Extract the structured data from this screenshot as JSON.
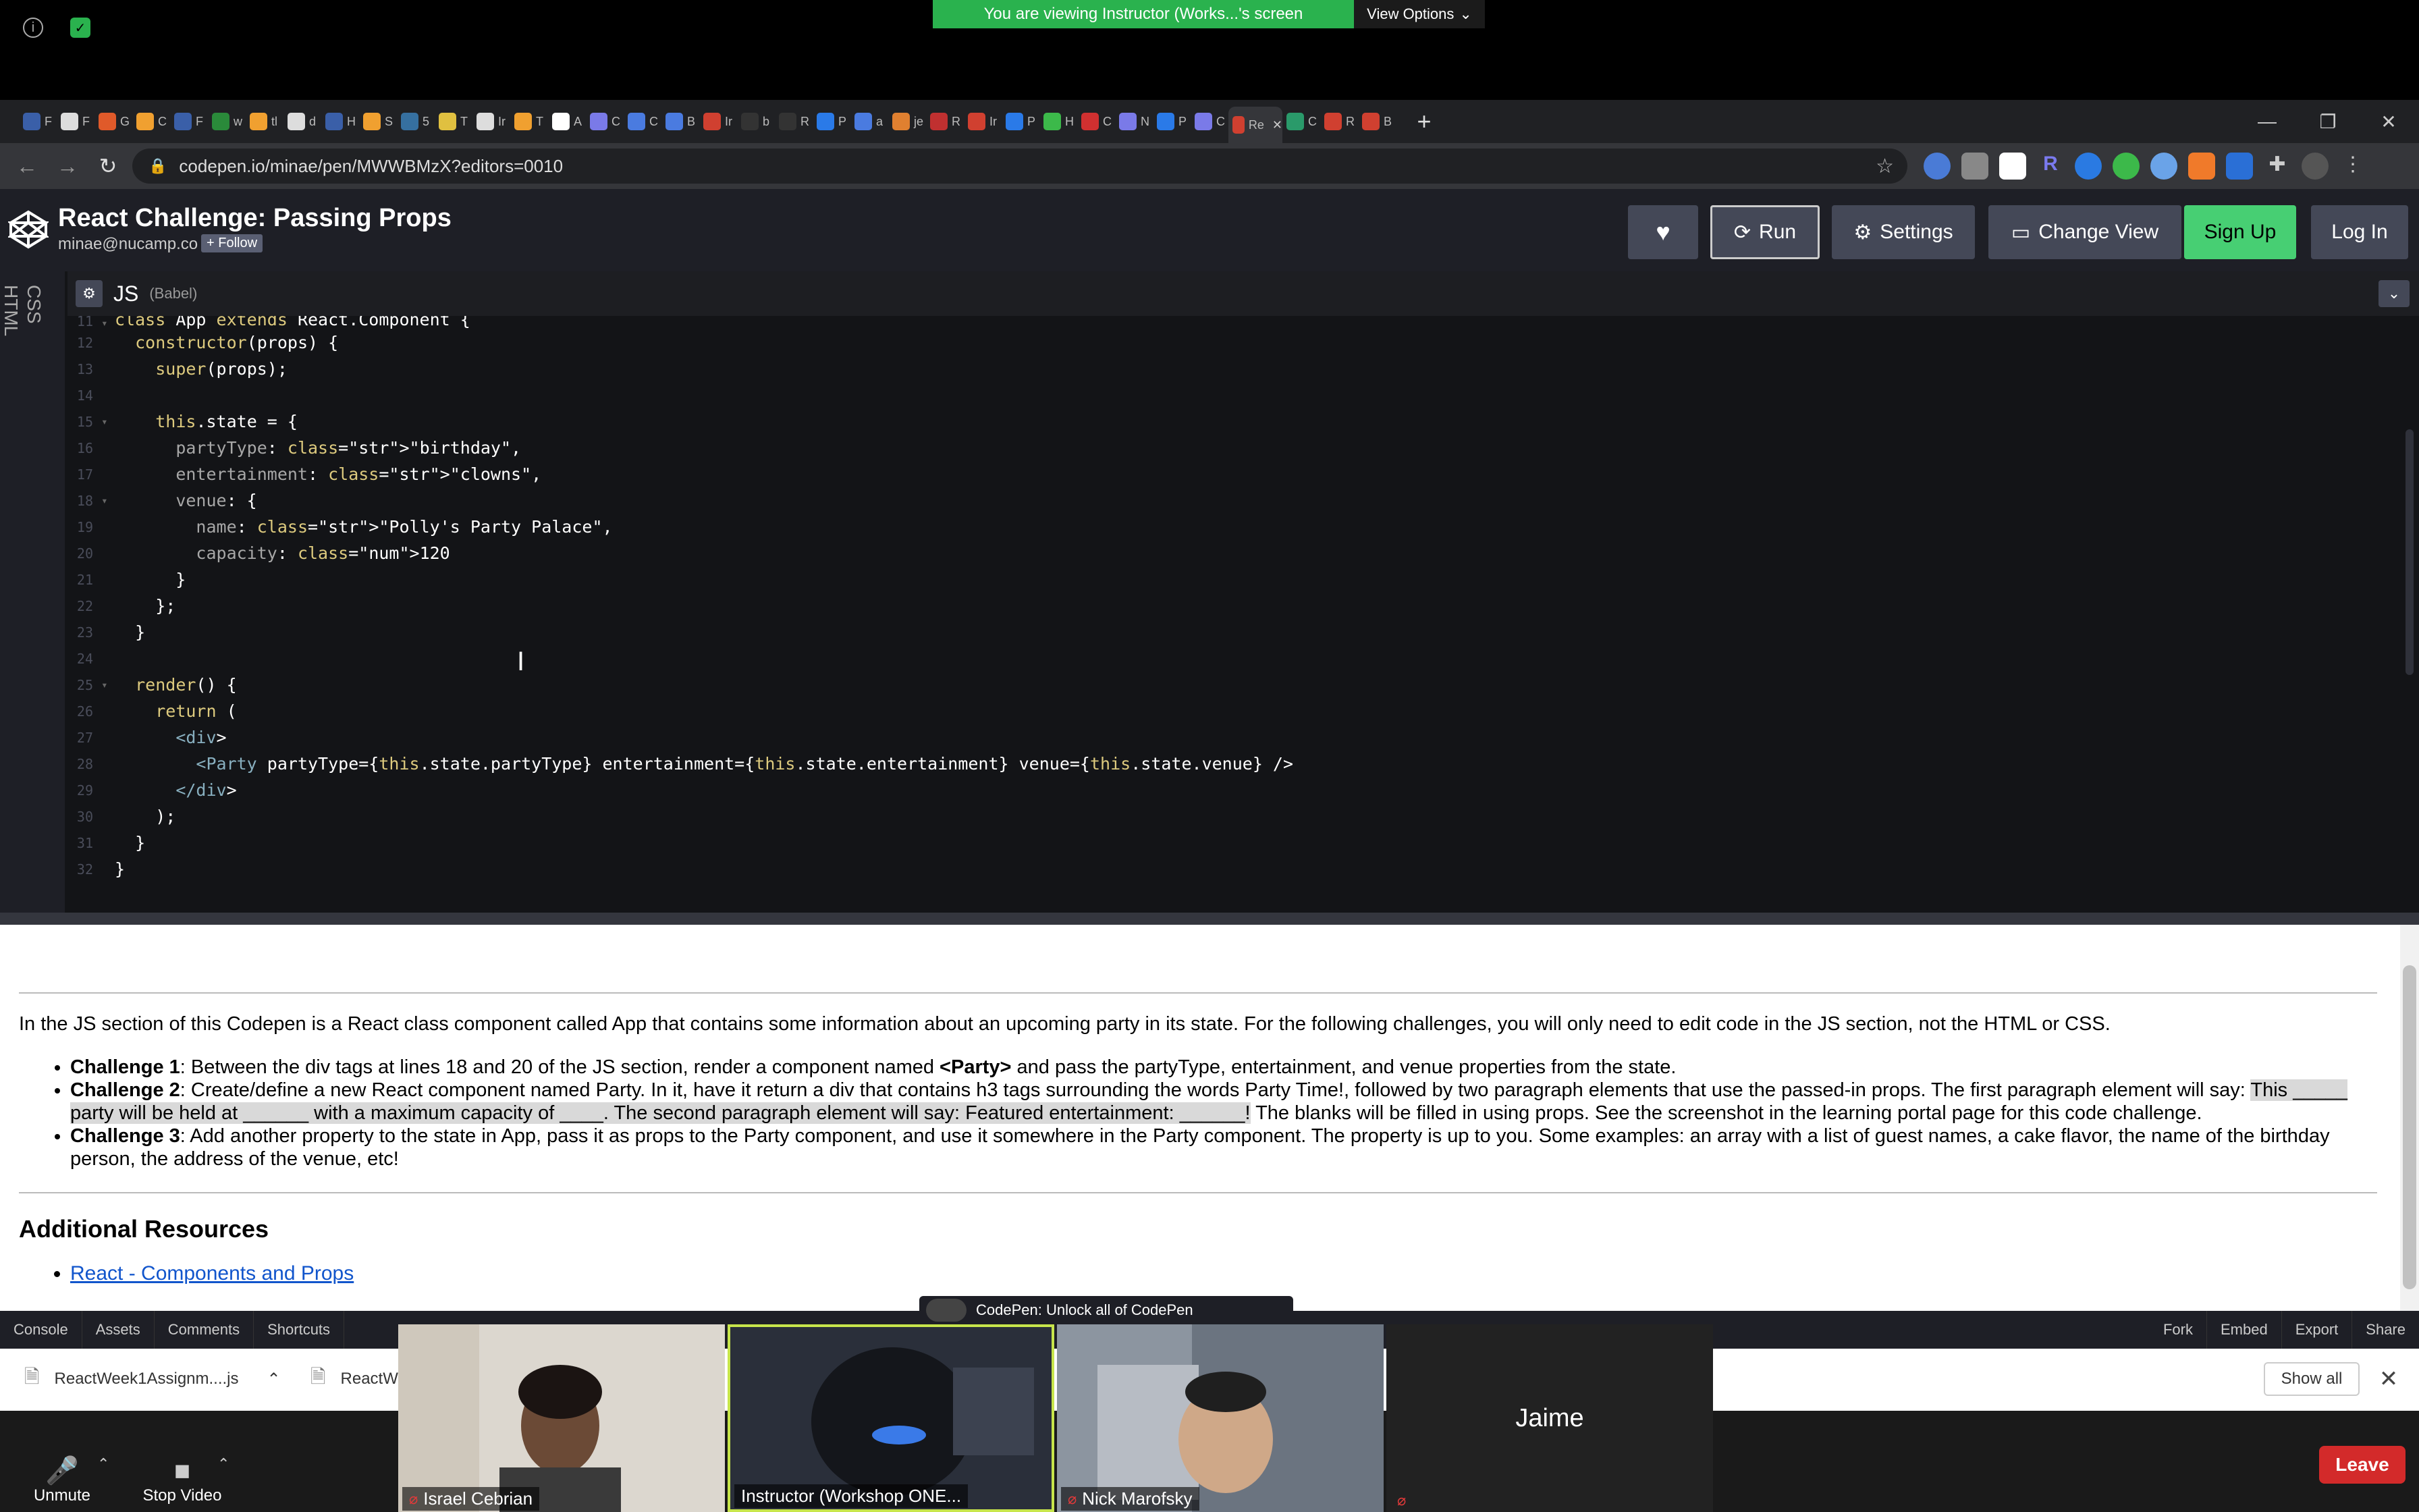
{
  "zoom": {
    "banner": "You are viewing Instructor (Works...'s screen",
    "view_options": "View Options",
    "unmute": "Unmute",
    "stop_video": "Stop Video",
    "leave": "Leave",
    "participants": [
      {
        "name": "Israel Cebrian",
        "muted": true
      },
      {
        "name": "Instructor (Workshop ONE...",
        "muted": false
      },
      {
        "name": "Nick Marofsky",
        "muted": true
      },
      {
        "name": "Jaime",
        "muted": true
      }
    ]
  },
  "browser": {
    "url": "codepen.io/minae/pen/MWWBMzX?editors=0010",
    "tab_letters": [
      "F",
      "F",
      "G",
      "C",
      "F",
      "w",
      "tl",
      "d",
      "H",
      "S",
      "5",
      "T",
      "Ir",
      "T",
      "A",
      "C",
      "C",
      "B",
      "Ir",
      "b",
      "R",
      "P",
      "a",
      "je",
      "R",
      "Ir",
      "P",
      "H",
      "C",
      "N",
      "P",
      "C",
      "Re",
      "C",
      "R",
      "B"
    ]
  },
  "codepen": {
    "title": "React Challenge: Passing Props",
    "author": "minae@nucamp.co",
    "follow": "+ Follow",
    "buttons": {
      "run": "Run",
      "settings": "Settings",
      "change_view": "Change View",
      "sign_up": "Sign Up",
      "log_in": "Log In"
    },
    "rail": {
      "css": "CSS",
      "html": "HTML"
    },
    "editor_lang": "JS",
    "editor_sub": "(Babel)",
    "footer": {
      "console": "Console",
      "assets": "Assets",
      "comments": "Comments",
      "shortcuts": "Shortcuts",
      "fork": "Fork",
      "embed": "Embed",
      "export": "Export",
      "share": "Share"
    },
    "promo": "CodePen: Unlock all of CodePen"
  },
  "code_lines": [
    {
      "n": "11",
      "text": "class App extends React.Component {"
    },
    {
      "n": "12",
      "text": "  constructor(props) {"
    },
    {
      "n": "13",
      "text": "    super(props);"
    },
    {
      "n": "14",
      "text": ""
    },
    {
      "n": "15",
      "text": "    this.state = {"
    },
    {
      "n": "16",
      "text": "      partyType: \"birthday\","
    },
    {
      "n": "17",
      "text": "      entertainment: \"clowns\","
    },
    {
      "n": "18",
      "text": "      venue: {"
    },
    {
      "n": "19",
      "text": "        name: \"Polly's Party Palace\","
    },
    {
      "n": "20",
      "text": "        capacity: 120"
    },
    {
      "n": "21",
      "text": "      }"
    },
    {
      "n": "22",
      "text": "    };"
    },
    {
      "n": "23",
      "text": "  }"
    },
    {
      "n": "24",
      "text": ""
    },
    {
      "n": "25",
      "text": "  render() {"
    },
    {
      "n": "26",
      "text": "    return ("
    },
    {
      "n": "27",
      "text": "      <div>"
    },
    {
      "n": "28",
      "text": "        <Party partyType={this.state.partyType} entertainment={this.state.entertainment} venue={this.state.venue} />"
    },
    {
      "n": "29",
      "text": "      </div>"
    },
    {
      "n": "30",
      "text": "    );"
    },
    {
      "n": "31",
      "text": "  }"
    },
    {
      "n": "32",
      "text": "}"
    }
  ],
  "preview": {
    "intro": "In the JS section of this Codepen is a React class component called App that contains some information about an upcoming party in its state. For the following challenges, you will only need to edit code in the JS section, not the HTML or CSS.",
    "c1_label": "Challenge 1",
    "c1_a": ": Between the div tags at lines 18 and 20 of the JS section, render a component named ",
    "c1_b": "<Party>",
    "c1_c": " and pass the partyType, entertainment, and venue properties from the state.",
    "c2_label": "Challenge 2",
    "c2_a": ": Create/define a new React component named Party. In it, have it return a div that contains h3 tags surrounding the words Party Time!, followed by two paragraph elements that use the passed-in props. The first paragraph element will say: ",
    "c2_hl": "This _____ party will be held at ______ with a maximum capacity of ____. The second paragraph element will say: Featured entertainment: ______!",
    "c2_c": " The blanks will be filled in using props. See the screenshot in the learning portal page for this code challenge.",
    "c3_label": "Challenge 3",
    "c3_a": ": Add another property to the state in App, pass it as props to the Party component, and use it somewhere in the Party component. The property is up to you. Some examples: an array with a list of guest names, a cake flavor, the name of the birthday person, the address of the venue, etc!",
    "resources_title": "Additional Resources",
    "resources_link": "React - Components and Props"
  },
  "downloads": {
    "file1": "ReactWeek1Assignm....js",
    "file2": "ReactW",
    "show_all": "Show all"
  },
  "colors": {
    "run_border": "#ccc",
    "signup": "#47cf73",
    "zoom_green": "#2ab24e",
    "leave": "#d32a2a"
  }
}
